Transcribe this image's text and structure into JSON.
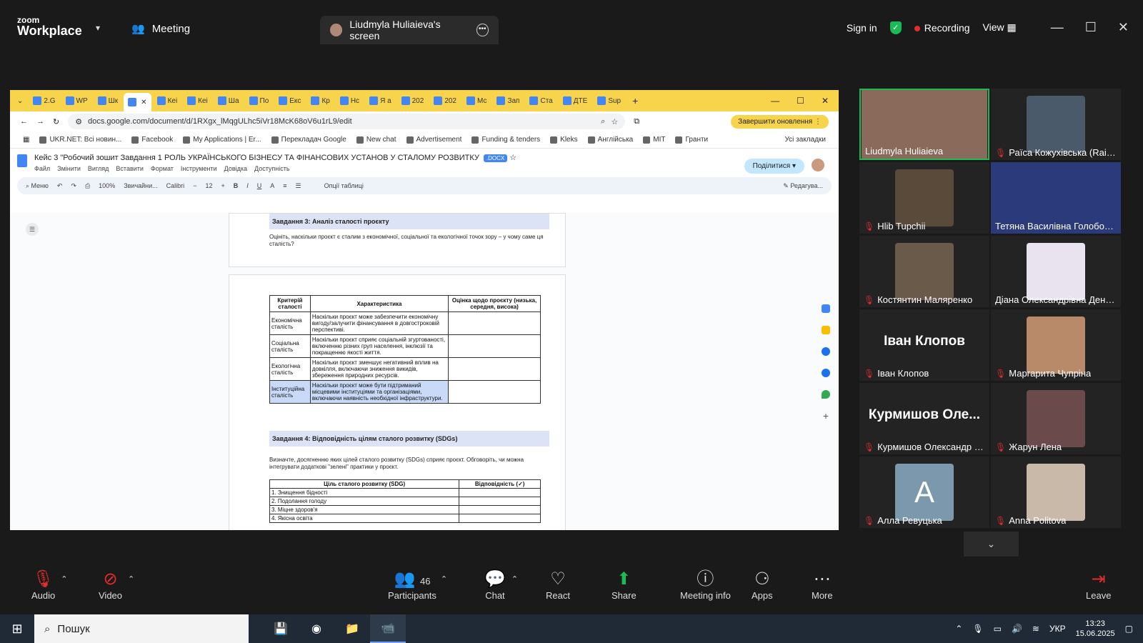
{
  "zoom": {
    "logo_line1": "zoom",
    "logo_line2": "Workplace",
    "meeting_label": "Meeting",
    "screen_tab": "Liudmyla Huliaieva's screen",
    "sign_in": "Sign in",
    "recording": "Recording",
    "view": "View"
  },
  "browser": {
    "tabs": [
      "2.G",
      "WP",
      "Шк",
      "",
      "Кеі",
      "Кеі",
      "Ша",
      "По",
      "Екс",
      "Кр",
      "Нс",
      "Я а",
      "202",
      "202",
      "Мс",
      "Зап",
      "Ста",
      "ДТЕ",
      "Sup"
    ],
    "url": "docs.google.com/document/d/1RXgx_lMqgULhc5iVr18McK68oV6u1rL9/edit",
    "finish_update": "Завершити оновлення",
    "bookmarks": [
      "UKR.NET: Всі новин...",
      "Facebook",
      "My Applications | Er...",
      "Перекладач Google",
      "New chat",
      "Advertisement",
      "Funding & tenders",
      "Kleks",
      "Англійська",
      "MIT",
      "Гранти"
    ],
    "all_bookmarks": "Усі закладки"
  },
  "doc": {
    "title": "Кейс 3 \"Робочий зошит Завдання 1 РОЛЬ УКРАЇНСЬКОГО БІЗНЕСУ ТА ФІНАНСОВИХ УСТАНОВ У СТАЛОМУ РОЗВИТКУ",
    "badge": ".DOCX",
    "menu": [
      "Файл",
      "Змінити",
      "Вигляд",
      "Вставити",
      "Формат",
      "Інструменти",
      "Довідка",
      "Доступність"
    ],
    "share": "Поділитися",
    "toolbar": {
      "menu": "Меню",
      "zoom": "100%",
      "style": "Звичайни...",
      "font": "Calibri",
      "size": "12",
      "table_options": "Опції таблиці",
      "edit_mode": "Редагува..."
    },
    "task3_heading": "Завдання 3: Аналіз сталості проєкту",
    "task3_text": "Оцініть, наскільки проєкт є сталим з економічної, соціальної та екологічної точок зору – у чому саме ця сталість?",
    "criteria_table": {
      "headers": [
        "Критерій сталості",
        "Характеристика",
        "Оцінка щодо проєкту (низька, середня, висока)"
      ],
      "rows": [
        [
          "Економічна сталість",
          "Наскільки проєкт може забезпечити економічну вигоду/залучити фінансування в довгостроковій перспективі.",
          ""
        ],
        [
          "Соціальна сталість",
          "Наскільки проєкт сприяє соціальній згуртованості, включенню різних груп населення, інклюзії та покращенню якості життя.",
          ""
        ],
        [
          "Екологічна сталість",
          "Наскільки проєкт зменшує негативний вплив на довкілля, включаючи зниження викидів, збереження природних ресурсів.",
          ""
        ],
        [
          "Інституційна сталість",
          "Наскільки проєкт може бути підтриманий місцевими інституціями та організаціями, включаючи наявність необхідної інфраструктури.",
          ""
        ]
      ]
    },
    "task4_heading": "Завдання 4: Відповідність цілям сталого розвитку (SDGs)",
    "task4_text": "Визначте, досягненню яких цілей сталого розвитку (SDGs) сприяє проєкт. Обговоріть, чи можна інтегрувати додаткові \"зелені\" практики у проєкт.",
    "sdg_table": {
      "headers": [
        "Ціль сталого розвитку (SDG)",
        "Відповідність (✓)"
      ],
      "rows": [
        "1. Знищення бідності",
        "2. Подолання голоду",
        "3. Міцне здоров'я",
        "4. Якісна освіта"
      ]
    }
  },
  "participants": [
    {
      "name": "Liudmyla Huliaieva",
      "muted": false,
      "color": "#8a6a5a"
    },
    {
      "name": "Раїса Кожухівська (Raisa ...",
      "muted": true,
      "color": "#4a5a6a"
    },
    {
      "name": "Hlib Tupchii",
      "muted": true,
      "color": "#5a4a3a"
    },
    {
      "name": "Тетяна Василівна Голоборо...",
      "muted": false,
      "color": "#2a3a7a"
    },
    {
      "name": "Костянтин Маляренко",
      "muted": true,
      "color": "#6a5a4a"
    },
    {
      "name": "Діана Олександрівна Денис...",
      "muted": false,
      "color": "#e9e2ef"
    },
    {
      "name": "Іван Клопов",
      "muted": true,
      "big": "Іван Клопов"
    },
    {
      "name": "Маргарита Чупріна",
      "muted": true,
      "color": "#b88a6a"
    },
    {
      "name": "Курмишов Олександр У...",
      "muted": true,
      "big": "Курмишов Оле..."
    },
    {
      "name": "Жарун Лена",
      "muted": true,
      "color": "#6a4a4a"
    },
    {
      "name": "Алла Ревуцька",
      "muted": true,
      "letter": "A",
      "color": "#7b98ad"
    },
    {
      "name": "Anna Politova",
      "muted": true,
      "color": "#c9b9a9"
    }
  ],
  "toolbar": {
    "audio": "Audio",
    "video": "Video",
    "participants": "Participants",
    "participant_count": "46",
    "chat": "Chat",
    "react": "React",
    "share": "Share",
    "meeting_info": "Meeting info",
    "apps": "Apps",
    "more": "More",
    "leave": "Leave"
  },
  "taskbar": {
    "search": "Пошук",
    "lang": "УКР",
    "time": "13:23",
    "date": "15.06.2025"
  }
}
